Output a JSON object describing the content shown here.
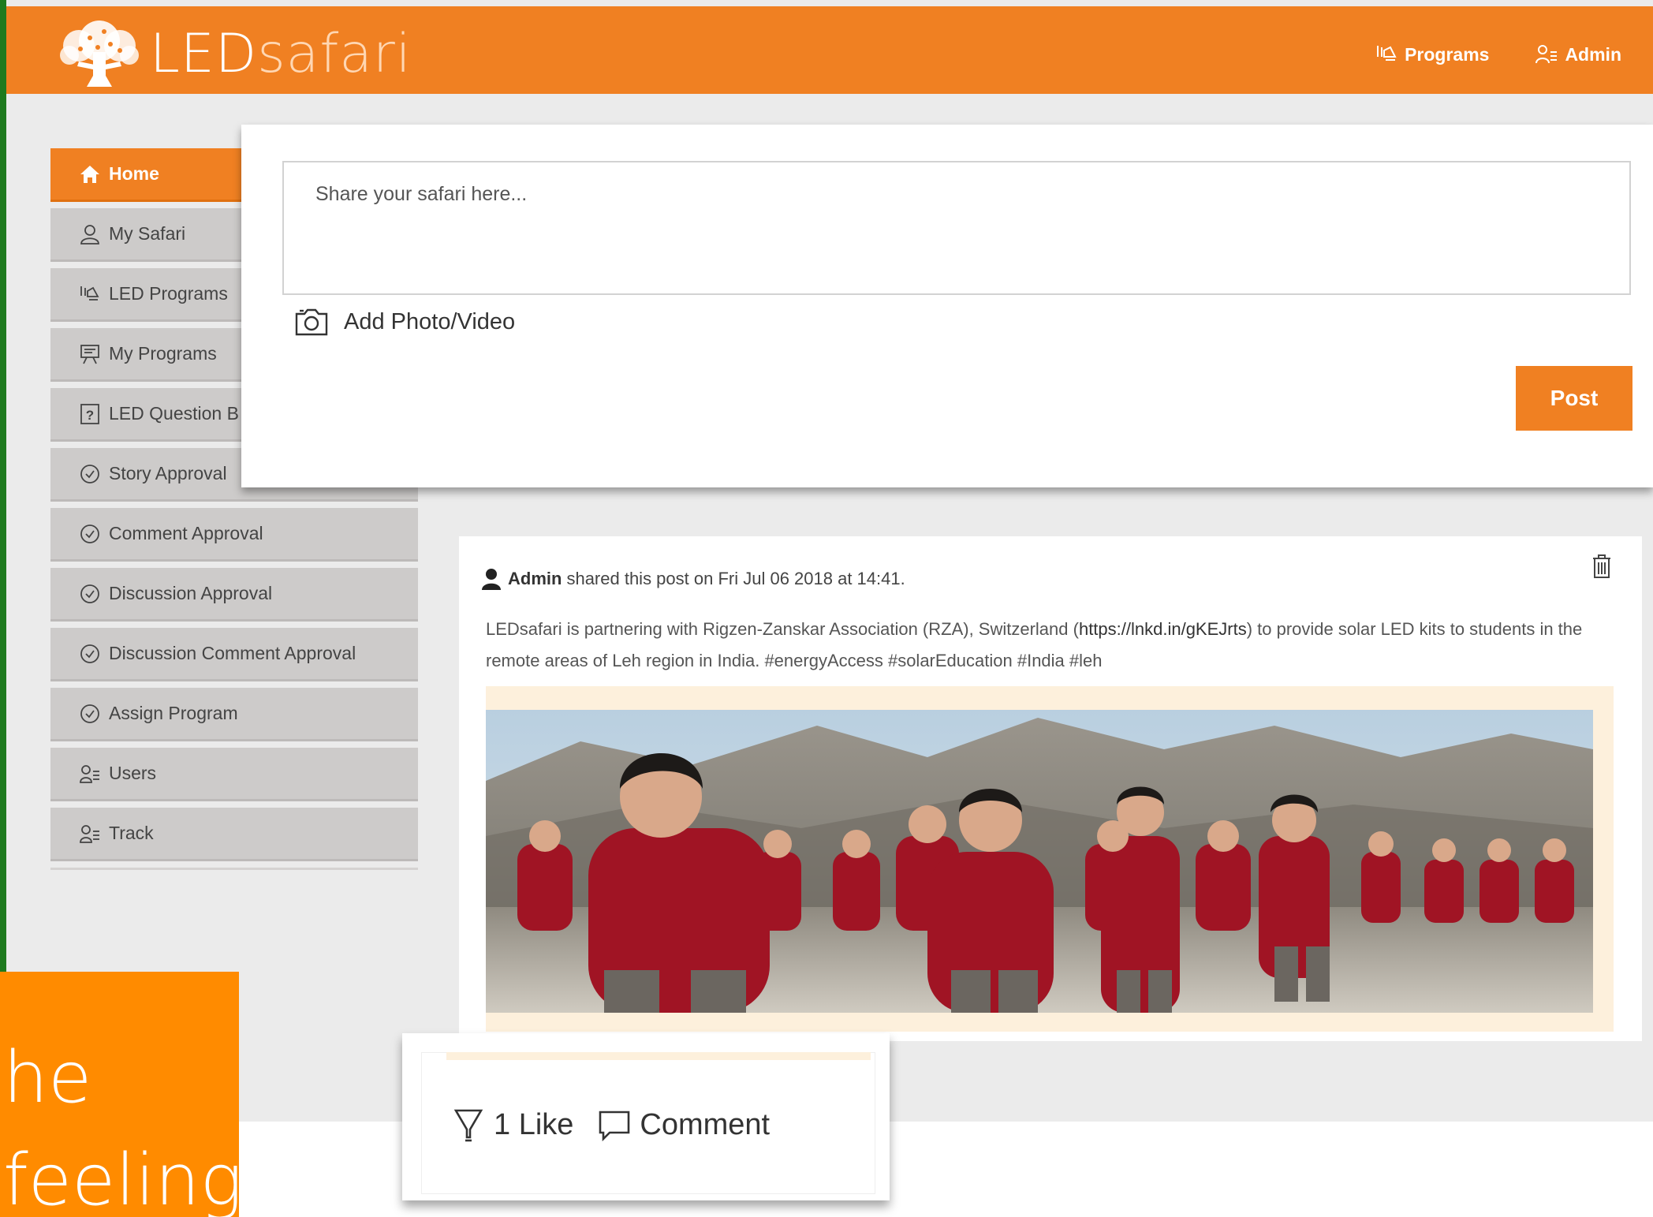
{
  "header": {
    "logo_main": "LED",
    "logo_sub": "safari",
    "nav": [
      {
        "label": "Programs",
        "icon": "programs-icon"
      },
      {
        "label": "Admin",
        "icon": "admin-users-icon"
      }
    ]
  },
  "sidebar": {
    "items": [
      {
        "label": "Home",
        "icon": "home-icon",
        "active": true
      },
      {
        "label": "My Safari",
        "icon": "user-icon"
      },
      {
        "label": "LED Programs",
        "icon": "programs-icon"
      },
      {
        "label": "My Programs",
        "icon": "presentation-icon"
      },
      {
        "label": "LED Question B",
        "icon": "question-icon"
      },
      {
        "label": "Story Approval",
        "icon": "check-circle-icon"
      },
      {
        "label": "Comment Approval",
        "icon": "check-circle-icon"
      },
      {
        "label": "Discussion Approval",
        "icon": "check-circle-icon"
      },
      {
        "label": "Discussion Comment Approval",
        "icon": "check-circle-icon"
      },
      {
        "label": "Assign Program",
        "icon": "check-circle-icon"
      },
      {
        "label": "Users",
        "icon": "users-icon"
      },
      {
        "label": "Track",
        "icon": "users-icon"
      }
    ]
  },
  "composer": {
    "placeholder": "Share your safari here...",
    "add_media_label": "Add Photo/Video",
    "post_label": "Post"
  },
  "post": {
    "author": "Admin",
    "meta": "shared this post on Fri Jul 06 2018 at 14:41.",
    "text_before": "LEDsafari is partnering with Rigzen-Zanskar Association (RZA), Switzerland (",
    "link": "https://lnkd.in/gKEJrts",
    "text_after": ") to provide solar LED kits to students in the remote areas of Leh region in India. #energyAccess #solarEducation #India #leh"
  },
  "actions": {
    "like_label": "1 Like",
    "comment_label": "Comment"
  },
  "overlay": {
    "line1": "he",
    "line2": "feeling"
  },
  "colors": {
    "brand_orange": "#f08022",
    "overlay_orange": "#ff8b00",
    "sidebar_gray": "#cdcbca"
  }
}
